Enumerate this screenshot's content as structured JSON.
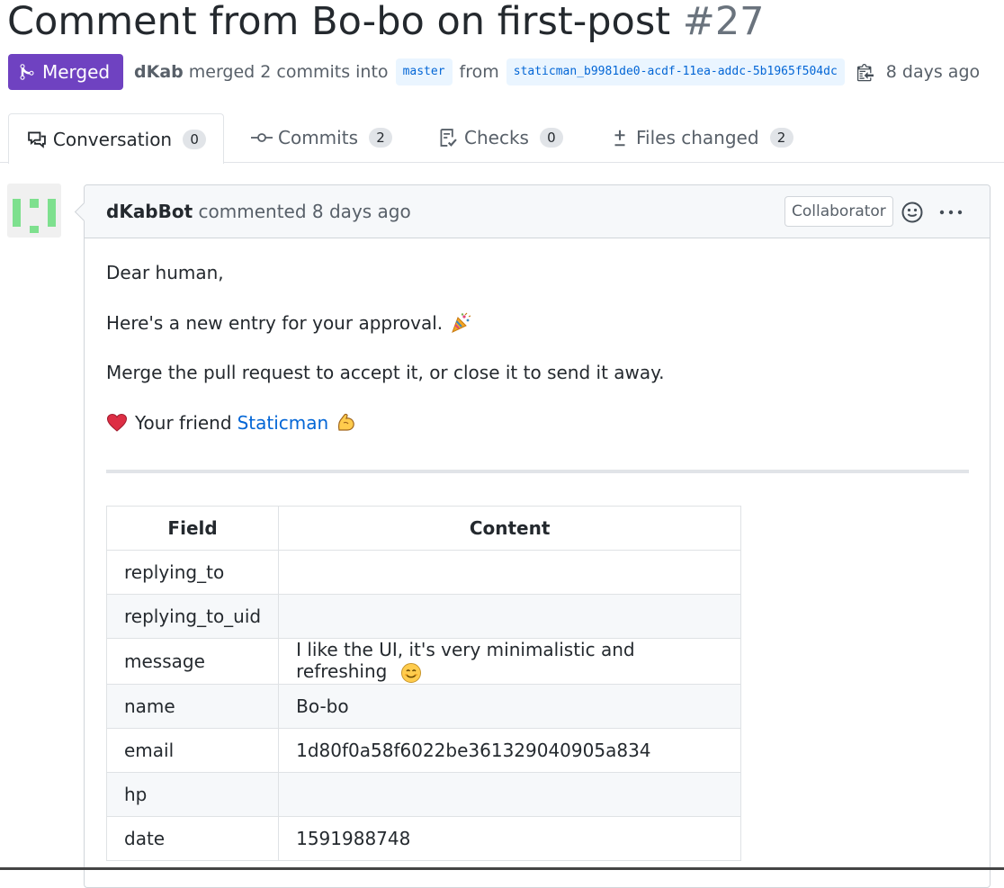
{
  "pr": {
    "title": "Comment from Bo-bo on first-post",
    "number": "#27",
    "state": "Merged",
    "author": "dKab",
    "action_text": "merged 2 commits into",
    "base_branch": "master",
    "from_text": "from",
    "head_branch": "staticman_b9981de0-acdf-11ea-addc-5b1965f504dc",
    "time": "8 days ago"
  },
  "tabs": [
    {
      "label": "Conversation",
      "count": "0",
      "icon": "comment-discussion-icon",
      "selected": true
    },
    {
      "label": "Commits",
      "count": "2",
      "icon": "git-commit-icon"
    },
    {
      "label": "Checks",
      "count": "0",
      "icon": "checklist-icon"
    },
    {
      "label": "Files changed",
      "count": "2",
      "icon": "diff-icon"
    }
  ],
  "comment": {
    "author": "dKabBot",
    "action": "commented 8 days ago",
    "role": "Collaborator",
    "greeting": "Dear human,",
    "line1": "Here's a new entry for your approval.",
    "line2": "Merge the pull request to accept it, or close it to send it away.",
    "signoff": "Your friend",
    "signoff_link": "Staticman"
  },
  "table": {
    "headers": [
      "Field",
      "Content"
    ],
    "rows": [
      {
        "field": "replying_to",
        "content": ""
      },
      {
        "field": "replying_to_uid",
        "content": ""
      },
      {
        "field": "message",
        "content": "I like the UI, it's very minimalistic and refreshing"
      },
      {
        "field": "name",
        "content": "Bo-bo"
      },
      {
        "field": "email",
        "content": "1d80f0a58f6022be361329040905a834"
      },
      {
        "field": "hp",
        "content": ""
      },
      {
        "field": "date",
        "content": "1591988748"
      }
    ]
  },
  "colors": {
    "merged": "#6f42c1",
    "link": "#0366d6",
    "avatar": "#7ee08e"
  }
}
